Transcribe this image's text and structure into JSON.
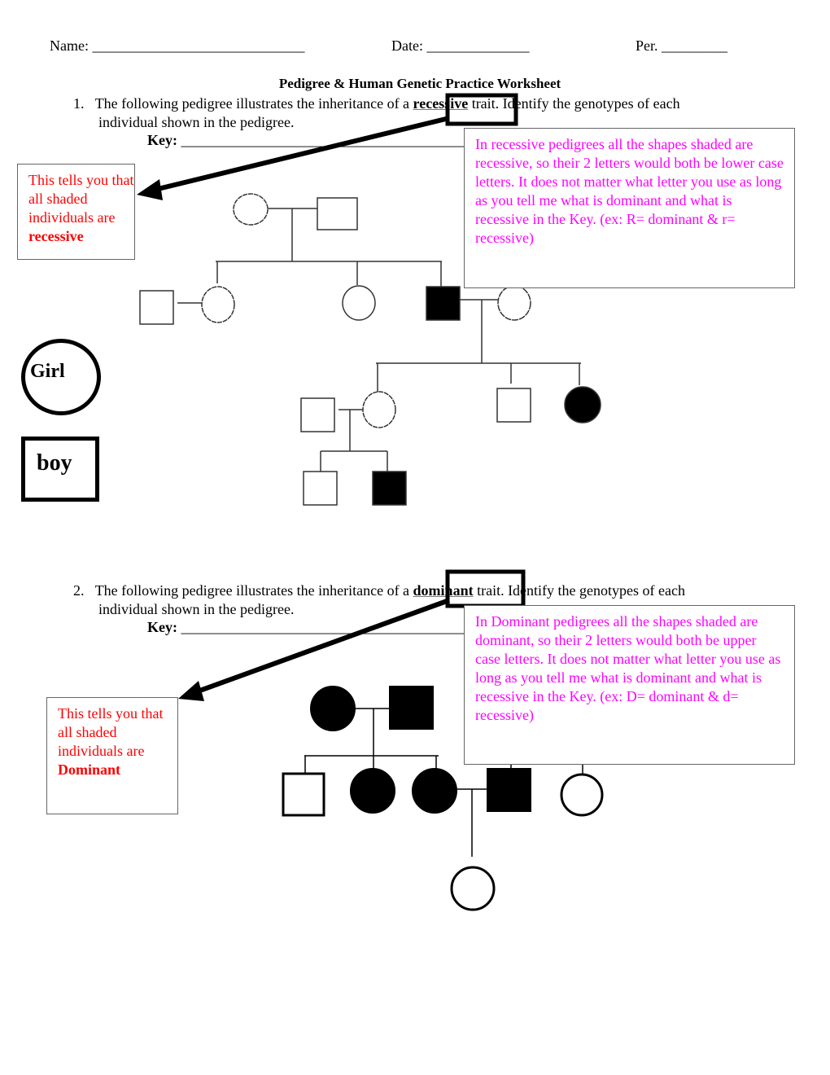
{
  "header": {
    "name_label": "Name:",
    "name_blank": "_____________________________",
    "date_label": "Date:",
    "date_blank": "______________",
    "per_label": "Per.",
    "per_blank": "_________"
  },
  "title": "Pedigree & Human Genetic Practice Worksheet",
  "questions": [
    {
      "number": "1.",
      "text_before": "The following pedigree illustrates the inheritance of a",
      "keyword": "recessive",
      "text_after": "trait. Identify the genotypes of each",
      "line2": "individual shown in the pedigree.",
      "key_label": "Key:",
      "key_blank": "_____________________________________________",
      "note": "In recessive pedigrees all the shapes shaded are recessive, so their 2 letters would both be lower case letters. It does not matter what letter you use as long as you tell me what is dominant and what is recessive in the Key. (ex: R= dominant & r= recessive)",
      "tell_text": "This tells you that all shaded individuals are",
      "tell_bold": "recessive"
    },
    {
      "number": "2.",
      "text_before": "The following pedigree illustrates the inheritance of a",
      "keyword": "dominant",
      "text_after": "trait. Identify the genotypes of each",
      "line2": "individual shown in the pedigree.",
      "key_label": "Key:",
      "key_blank": "_____________________________________________",
      "note": "In Dominant pedigrees all the shapes shaded are dominant, so their 2 letters would both be upper case letters. It does not matter what letter you use as long as you tell me what is dominant and what is recessive in the Key. (ex: D= dominant & d= recessive)",
      "tell_text": "This tells you that all shaded individuals are",
      "tell_bold": "Dominant"
    }
  ],
  "legend": {
    "girl": "Girl",
    "boy": "boy"
  },
  "colors": {
    "note_text": "#ff00ff",
    "tell_text": "#ff0000",
    "shaded": "#000000"
  },
  "pedigree1": {
    "trait": "recessive",
    "individuals": [
      {
        "id": "g1-mother",
        "sex": "female",
        "shaded": false
      },
      {
        "id": "g1-father",
        "sex": "male",
        "shaded": false
      },
      {
        "id": "g2-inlaw-husband",
        "sex": "male",
        "shaded": false
      },
      {
        "id": "g2-daughter-1",
        "sex": "female",
        "shaded": false
      },
      {
        "id": "g2-daughter-2",
        "sex": "female",
        "shaded": false
      },
      {
        "id": "g2-son",
        "sex": "male",
        "shaded": true
      },
      {
        "id": "g2-inlaw-wife",
        "sex": "female",
        "shaded": false
      },
      {
        "id": "g3-inlaw-husband",
        "sex": "male",
        "shaded": false
      },
      {
        "id": "g3-daughter",
        "sex": "female",
        "shaded": false
      },
      {
        "id": "g3-son",
        "sex": "male",
        "shaded": false
      },
      {
        "id": "g3-daughter-2",
        "sex": "female",
        "shaded": true
      },
      {
        "id": "g4-son-1",
        "sex": "male",
        "shaded": false
      },
      {
        "id": "g4-son-2",
        "sex": "male",
        "shaded": true
      }
    ]
  },
  "pedigree2": {
    "trait": "dominant",
    "individuals": [
      {
        "id": "g1-mother",
        "sex": "female",
        "shaded": true
      },
      {
        "id": "g1-father",
        "sex": "male",
        "shaded": true
      },
      {
        "id": "g2-son",
        "sex": "male",
        "shaded": false
      },
      {
        "id": "g2-daughter-1",
        "sex": "female",
        "shaded": true
      },
      {
        "id": "g2-daughter-2",
        "sex": "female",
        "shaded": true
      },
      {
        "id": "g2-inlaw-husband",
        "sex": "male",
        "shaded": true
      },
      {
        "id": "g2-other-female",
        "sex": "female",
        "shaded": false
      },
      {
        "id": "g3-daughter",
        "sex": "female",
        "shaded": false
      }
    ]
  }
}
